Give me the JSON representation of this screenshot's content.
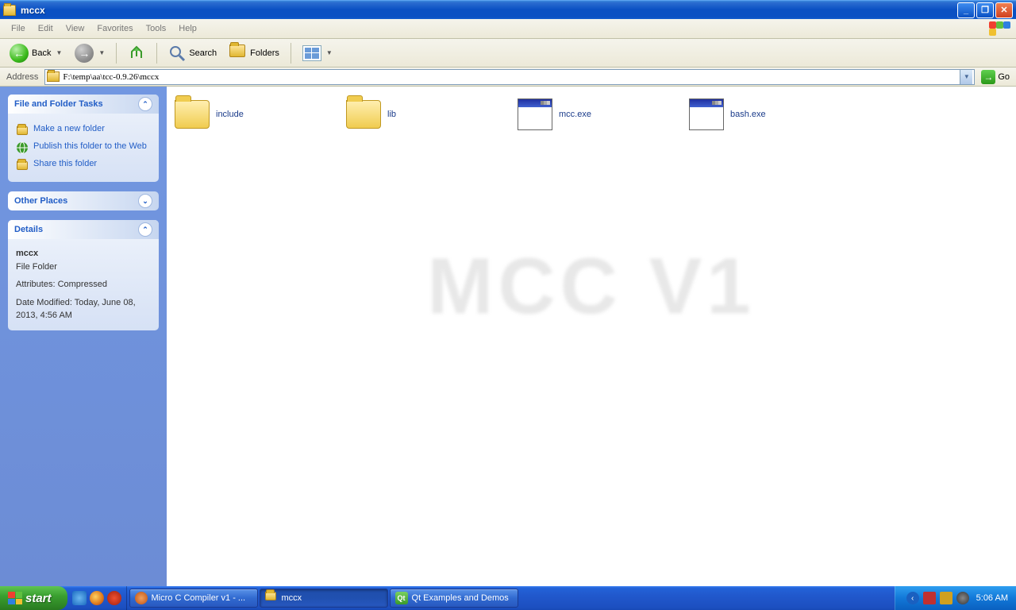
{
  "titlebar": {
    "title": "mccx"
  },
  "menu": {
    "file": "File",
    "edit": "Edit",
    "view": "View",
    "favorites": "Favorites",
    "tools": "Tools",
    "help": "Help"
  },
  "toolbar": {
    "back": "Back",
    "search": "Search",
    "folders": "Folders"
  },
  "addressbar": {
    "label": "Address",
    "path": "F:\\temp\\aa\\tcc-0.9.26\\mccx",
    "go": "Go"
  },
  "side": {
    "tasks": {
      "title": "File and Folder Tasks",
      "new_folder": "Make a new folder",
      "publish": "Publish this folder to the Web",
      "share": "Share this folder"
    },
    "places": {
      "title": "Other Places"
    },
    "details": {
      "title": "Details",
      "name": "mccx",
      "type": "File Folder",
      "attributes": "Attributes: Compressed",
      "modified": "Date Modified: Today, June 08, 2013, 4:56 AM"
    }
  },
  "files": {
    "f0": "include",
    "f1": "lib",
    "f2": "mcc.exe",
    "f3": "bash.exe"
  },
  "watermark": "MCC V1",
  "taskbar": {
    "start": "start",
    "app0": "Micro C Compiler v1 - ...",
    "app1": "mccx",
    "app2": "Qt Examples and Demos",
    "clock": "5:06 AM"
  }
}
